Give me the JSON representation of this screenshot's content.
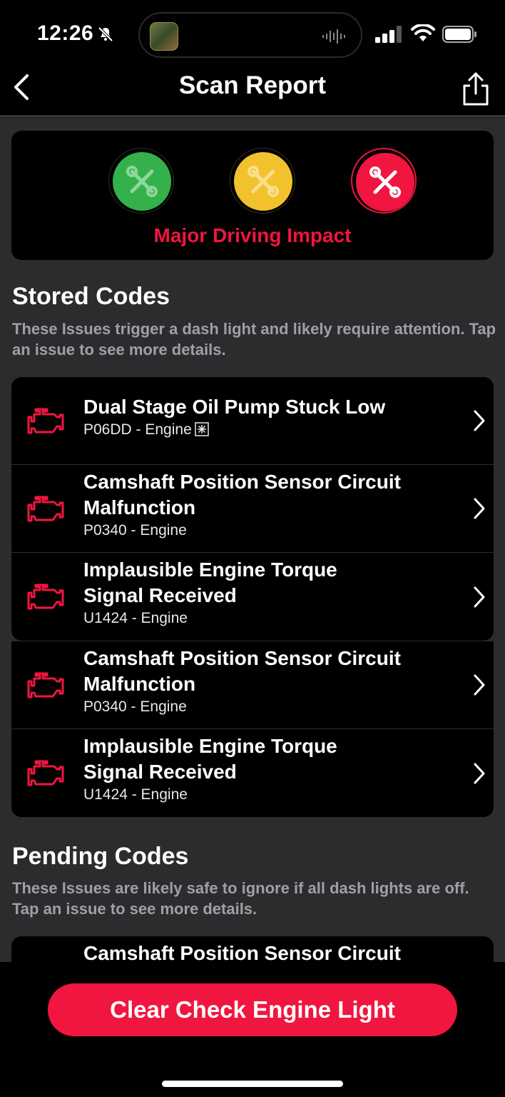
{
  "status_bar": {
    "time": "12:26",
    "icons": [
      "bell-slash-icon",
      "app-thumbnail",
      "audio-wave-icon",
      "signal-icon",
      "wifi-icon",
      "battery-icon"
    ]
  },
  "nav": {
    "title": "Scan Report",
    "back_icon": "chevron-left-icon",
    "share_icon": "share-icon"
  },
  "impact": {
    "label": "Major Driving Impact",
    "levels": [
      "green",
      "yellow",
      "red"
    ],
    "active_level": "red",
    "colors": {
      "green": "#34b14b",
      "yellow": "#f2c12e",
      "red": "#f0163f"
    }
  },
  "stored": {
    "title": "Stored Codes",
    "description": "These Issues trigger a dash light and likely require attention. Tap an issue to see more details.",
    "items": [
      {
        "title": "Dual Stage Oil Pump Stuck Low",
        "code": "P06DD - Engine",
        "freeze_frame": true
      },
      {
        "title": "Camshaft Position Sensor Circuit Malfunction",
        "code": "P0340 - Engine"
      },
      {
        "title": "Implausible Engine Torque Signal Received",
        "code": "U1424 - Engine"
      },
      {
        "title": "Camshaft Position Sensor Circuit Malfunction",
        "code": "P0340 - Engine"
      },
      {
        "title": "Implausible Engine Torque Signal Received",
        "code": "U1424 - Engine"
      }
    ]
  },
  "pending": {
    "title": "Pending Codes",
    "description": "These Issues are likely safe to ignore if all dash lights are off. Tap an issue to see more details.",
    "items": [
      {
        "title": "Camshaft Position Sensor Circuit"
      }
    ]
  },
  "actions": {
    "clear_label": "Clear Check Engine Light"
  },
  "accent_color": "#f0163f"
}
